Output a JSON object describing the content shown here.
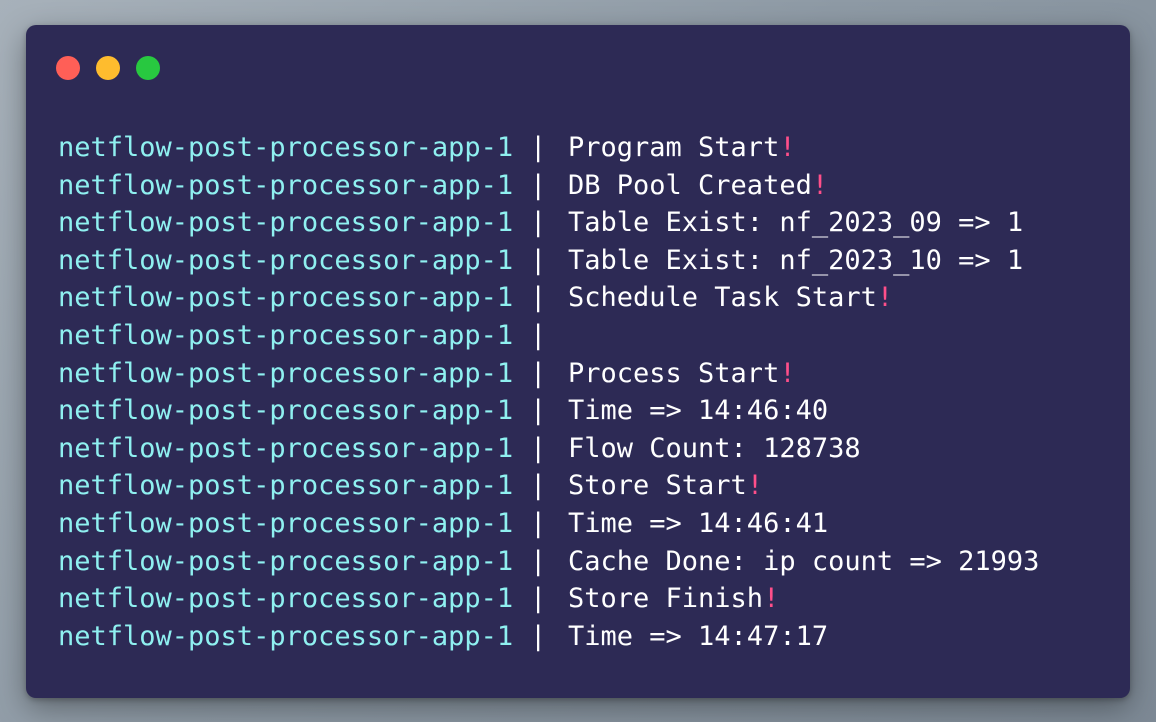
{
  "window": {
    "controls": [
      {
        "name": "close-button",
        "color": "#ff5f57"
      },
      {
        "name": "minimize-button",
        "color": "#febc2e"
      },
      {
        "name": "maximize-button",
        "color": "#28c840"
      }
    ]
  },
  "colors": {
    "background": "#2d2a55",
    "prefix": "#8ff0f0",
    "text": "#ffffff",
    "exclamation": "#ff4f8a"
  },
  "terminal": {
    "separator": "|",
    "lines": [
      {
        "prefix": "netflow-post-processor-app-1",
        "text": "Program Start",
        "excl": "!"
      },
      {
        "prefix": "netflow-post-processor-app-1",
        "text": "DB Pool Created",
        "excl": "!"
      },
      {
        "prefix": "netflow-post-processor-app-1",
        "text": "Table Exist: nf_2023_09 => 1",
        "excl": ""
      },
      {
        "prefix": "netflow-post-processor-app-1",
        "text": "Table Exist: nf_2023_10 => 1",
        "excl": ""
      },
      {
        "prefix": "netflow-post-processor-app-1",
        "text": "Schedule Task Start",
        "excl": "!"
      },
      {
        "prefix": "netflow-post-processor-app-1",
        "text": "",
        "excl": ""
      },
      {
        "prefix": "netflow-post-processor-app-1",
        "text": "Process Start",
        "excl": "!"
      },
      {
        "prefix": "netflow-post-processor-app-1",
        "text": "Time => 14:46:40",
        "excl": ""
      },
      {
        "prefix": "netflow-post-processor-app-1",
        "text": "Flow Count: 128738",
        "excl": ""
      },
      {
        "prefix": "netflow-post-processor-app-1",
        "text": "Store Start",
        "excl": "!"
      },
      {
        "prefix": "netflow-post-processor-app-1",
        "text": "Time => 14:46:41",
        "excl": ""
      },
      {
        "prefix": "netflow-post-processor-app-1",
        "text": "Cache Done: ip count => 21993",
        "excl": ""
      },
      {
        "prefix": "netflow-post-processor-app-1",
        "text": "Store Finish",
        "excl": "!"
      },
      {
        "prefix": "netflow-post-processor-app-1",
        "text": "Time => 14:47:17",
        "excl": ""
      }
    ]
  }
}
